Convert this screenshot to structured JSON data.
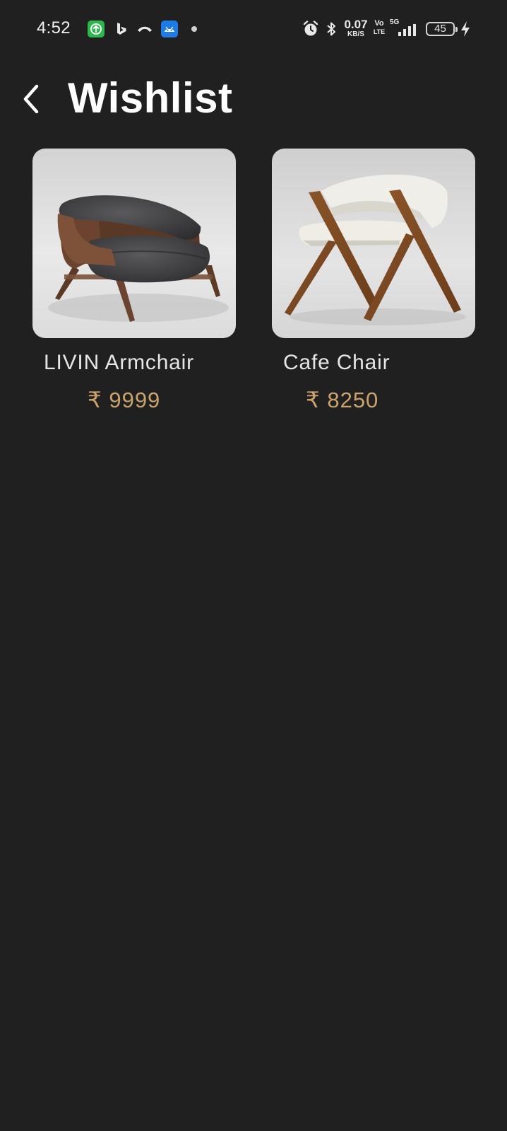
{
  "status_bar": {
    "time": "4:52",
    "network_speed": "0.07",
    "network_speed_unit": "KB/S",
    "volte_top": "Vo",
    "volte_bottom": "LTE",
    "network_type": "5G",
    "battery_level": "45",
    "notification_icons": [
      "app-update-icon",
      "bing-icon",
      "missed-call-icon",
      "android-app-icon"
    ],
    "system_icons": [
      "alarm-icon",
      "bluetooth-icon",
      "signal-icon",
      "battery-icon",
      "charging-icon"
    ]
  },
  "header": {
    "back_icon": "chevron-left-icon",
    "title": "Wishlist"
  },
  "wishlist": {
    "items": [
      {
        "name": "LIVIN Armchair",
        "price": "₹ 9999",
        "image": "grey-armchair-photo"
      },
      {
        "name": "Cafe Chair",
        "price": "₹ 8250",
        "image": "white-cafe-chair-photo"
      }
    ]
  },
  "colors": {
    "background": "#202020",
    "title_text": "#ffffff",
    "item_name_text": "#e6e6e6",
    "price_accent": "#c9a36b"
  }
}
